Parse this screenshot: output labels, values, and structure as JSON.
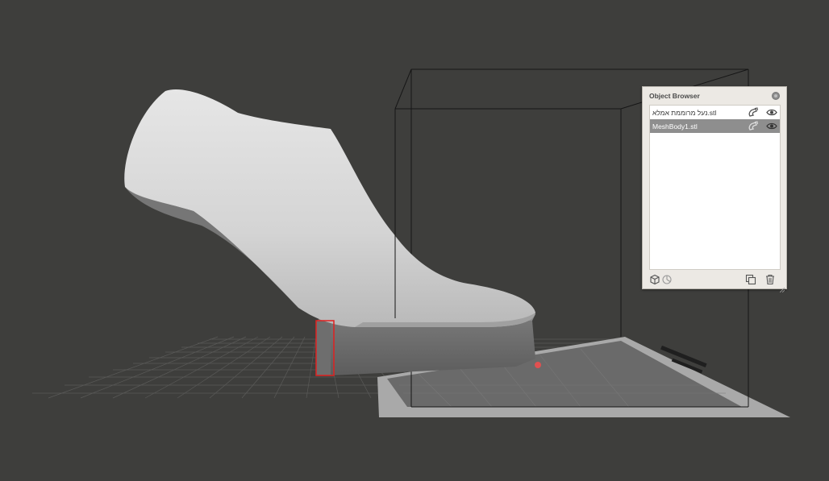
{
  "viewport": {
    "background": "#3e3e3c",
    "selection_color": "#e02020"
  },
  "object_browser": {
    "title": "Object Browser",
    "items": [
      {
        "label": "נעל מרוממת אמלא.stl",
        "selected": false
      },
      {
        "label": "MeshBody1.stl",
        "selected": true
      }
    ],
    "row_icons": [
      "magnet-icon",
      "eye-icon"
    ],
    "footer_icons": [
      "cube-icon",
      "pie-icon",
      "duplicate-icon",
      "trash-icon"
    ]
  }
}
